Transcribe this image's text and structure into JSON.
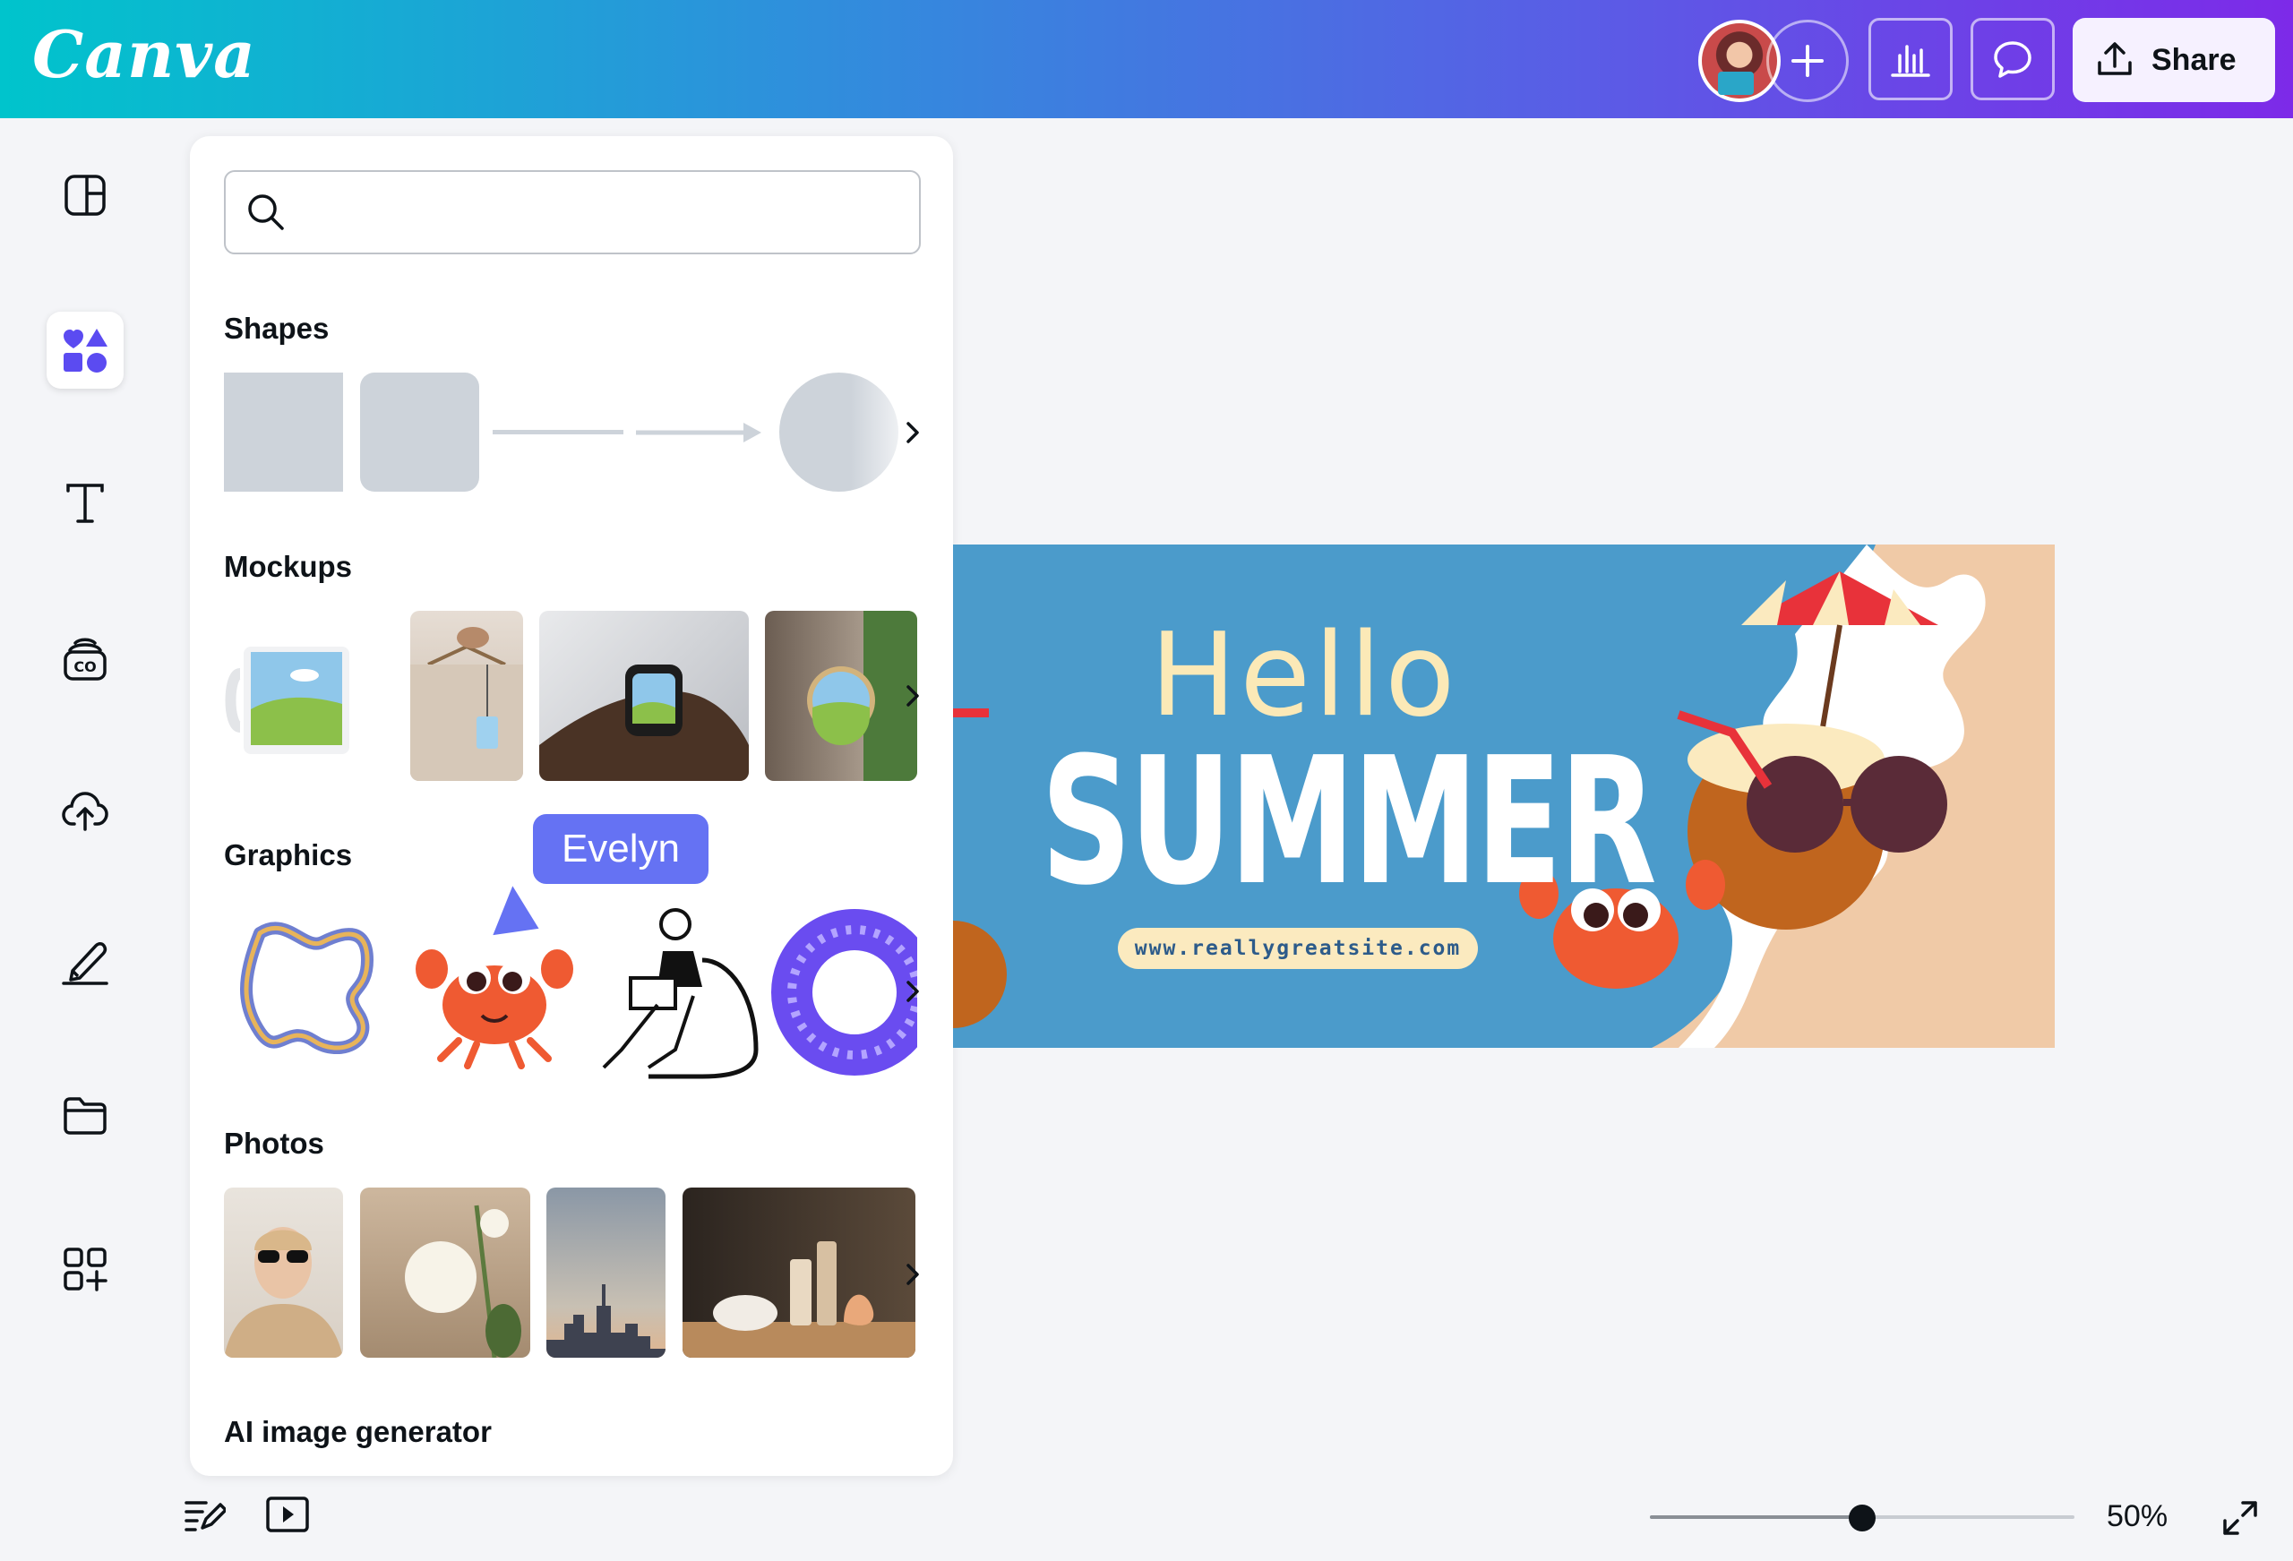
{
  "topbar": {
    "logo": "Canva",
    "share_label": "Share",
    "colors": {
      "gradient_start": "#00c4cc",
      "gradient_end": "#7d2ae8"
    }
  },
  "rail": {
    "items": [
      {
        "icon": "design-layout-icon",
        "active": false
      },
      {
        "icon": "elements-icon",
        "active": true
      },
      {
        "icon": "text-icon",
        "active": false
      },
      {
        "icon": "brand-icon",
        "active": false
      },
      {
        "icon": "uploads-icon",
        "active": false
      },
      {
        "icon": "draw-icon",
        "active": false
      },
      {
        "icon": "projects-icon",
        "active": false
      },
      {
        "icon": "apps-icon",
        "active": false
      }
    ]
  },
  "panel": {
    "search": {
      "placeholder": "",
      "value": ""
    },
    "sections": {
      "shapes": "Shapes",
      "mockups": "Mockups",
      "graphics": "Graphics",
      "photos": "Photos",
      "ai": "AI image generator"
    }
  },
  "collaborator": {
    "name": "Evelyn",
    "color": "#6572f3"
  },
  "design": {
    "line1": "Hello",
    "line2": "SUMMER",
    "url": "www.reallygreatsite.com"
  },
  "bottom": {
    "zoom": "50%",
    "zoom_level": 0.5
  }
}
